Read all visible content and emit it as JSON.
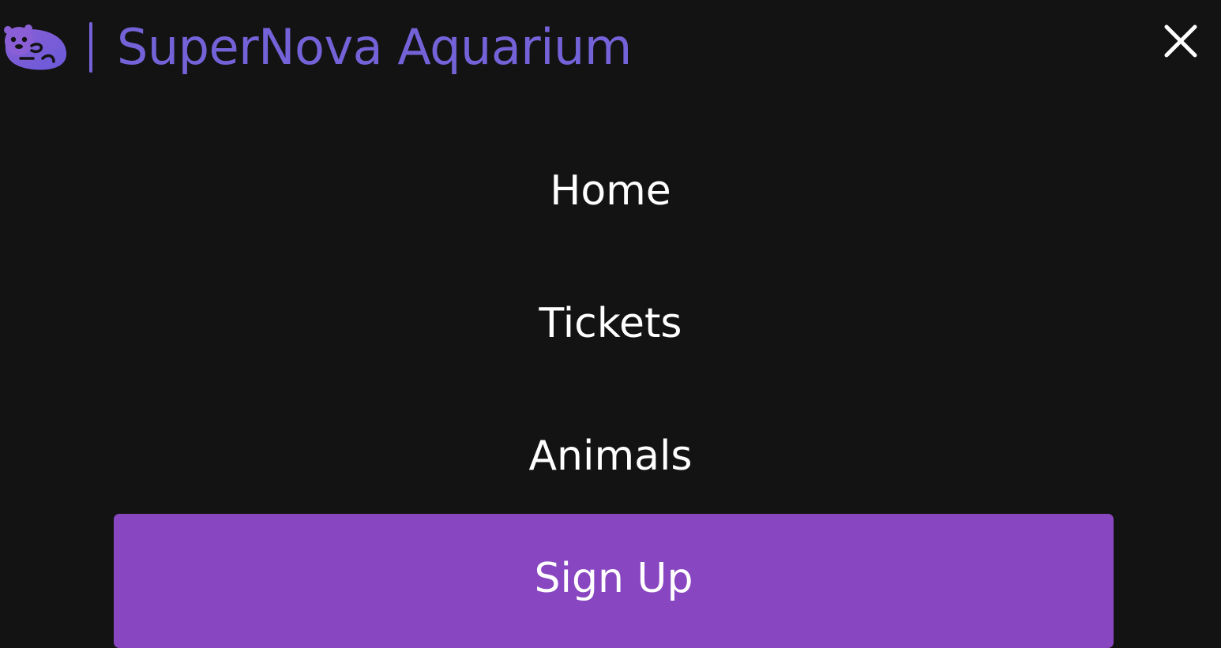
{
  "header": {
    "brand_title": "SuperNova Aquarium",
    "logo_icon": "otter-logo-icon",
    "close_icon": "close-icon"
  },
  "nav": {
    "items": [
      {
        "label": "Home"
      },
      {
        "label": "Tickets"
      },
      {
        "label": "Animals"
      }
    ],
    "signup_label": "Sign Up"
  },
  "colors": {
    "background": "#131313",
    "brand": "#7463d8",
    "signup_button": "#8846c0",
    "text": "#ffffff"
  }
}
